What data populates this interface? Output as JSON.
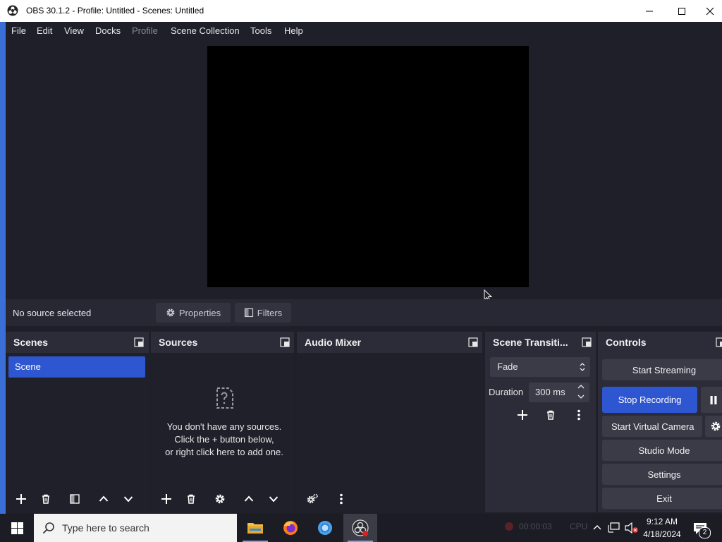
{
  "window": {
    "title": "OBS 30.1.2 - Profile: Untitled - Scenes: Untitled"
  },
  "menu": [
    {
      "label": "File",
      "enabled": true
    },
    {
      "label": "Edit",
      "enabled": true
    },
    {
      "label": "View",
      "enabled": true
    },
    {
      "label": "Docks",
      "enabled": true
    },
    {
      "label": "Profile",
      "enabled": false
    },
    {
      "label": "Scene Collection",
      "enabled": true
    },
    {
      "label": "Tools",
      "enabled": true
    },
    {
      "label": "Help",
      "enabled": true
    }
  ],
  "context": {
    "no_source": "No source selected",
    "properties": "Properties",
    "filters": "Filters"
  },
  "docks": {
    "scenes": {
      "title": "Scenes",
      "items": [
        "Scene"
      ]
    },
    "sources": {
      "title": "Sources",
      "empty_lines": [
        "You don't have any sources.",
        "Click the + button below,",
        "or right click here to add one."
      ]
    },
    "audio_mixer": {
      "title": "Audio Mixer"
    },
    "transitions": {
      "title": "Scene Transiti...",
      "selected": "Fade",
      "duration_label": "Duration",
      "duration_value": "300 ms"
    },
    "controls": {
      "title": "Controls",
      "start_streaming": "Start Streaming",
      "stop_recording": "Stop Recording",
      "start_virtual_camera": "Start Virtual Camera",
      "studio_mode": "Studio Mode",
      "settings": "Settings",
      "exit": "Exit"
    }
  },
  "statusbar": {
    "rec_time": "00:00:03",
    "cpu": "CPU"
  },
  "taskbar": {
    "search_placeholder": "Type here to search",
    "time": "9:12 AM",
    "date": "4/18/2024",
    "notification_count": "2"
  },
  "colors": {
    "accent": "#2e56d1",
    "background": "#1e1f29",
    "dock": "#2b2c37"
  }
}
